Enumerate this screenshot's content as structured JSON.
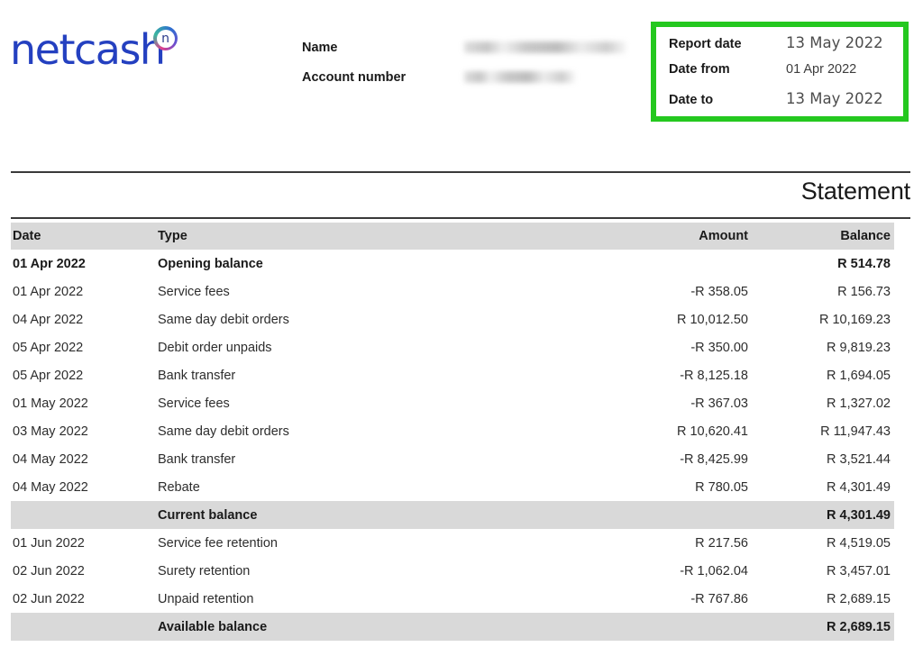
{
  "brand": {
    "logo_text": "netcash",
    "logo_mark_letter": "n",
    "logo_color": "#2440c0",
    "highlight_color": "#24c81f"
  },
  "account": {
    "rows": [
      {
        "label": "Name",
        "value": "",
        "redacted": true
      },
      {
        "label": "Account number",
        "value": "",
        "redacted": true
      }
    ]
  },
  "date_box": {
    "rows": [
      {
        "label": "Report date",
        "value": "13 May 2022"
      },
      {
        "label": "Date from",
        "value": "01 Apr 2022"
      },
      {
        "label": "Date to",
        "value": "13 May 2022"
      }
    ]
  },
  "statement": {
    "title": "Statement",
    "columns": [
      "Date",
      "Type",
      "Amount",
      "Balance"
    ],
    "rows": [
      {
        "date": "01 Apr 2022",
        "type": "Opening balance",
        "amount": "",
        "balance": "R 514.78",
        "style": "bold"
      },
      {
        "date": "01 Apr 2022",
        "type": "Service fees",
        "amount": "-R 358.05",
        "balance": "R 156.73",
        "style": "normal"
      },
      {
        "date": "04 Apr 2022",
        "type": "Same day debit orders",
        "amount": "R 10,012.50",
        "balance": "R 10,169.23",
        "style": "normal"
      },
      {
        "date": "05 Apr 2022",
        "type": "Debit order unpaids",
        "amount": "-R 350.00",
        "balance": "R 9,819.23",
        "style": "normal"
      },
      {
        "date": "05 Apr 2022",
        "type": "Bank transfer",
        "amount": "-R 8,125.18",
        "balance": "R 1,694.05",
        "style": "normal"
      },
      {
        "date": "01 May 2022",
        "type": "Service fees",
        "amount": "-R 367.03",
        "balance": "R 1,327.02",
        "style": "normal"
      },
      {
        "date": "03 May 2022",
        "type": "Same day debit orders",
        "amount": "R 10,620.41",
        "balance": "R 11,947.43",
        "style": "normal"
      },
      {
        "date": "04 May 2022",
        "type": "Bank transfer",
        "amount": "-R 8,425.99",
        "balance": "R 3,521.44",
        "style": "normal"
      },
      {
        "date": "04 May 2022",
        "type": "Rebate",
        "amount": "R 780.05",
        "balance": "R 4,301.49",
        "style": "normal"
      },
      {
        "date": "",
        "type": "Current balance",
        "amount": "",
        "balance": "R 4,301.49",
        "style": "total"
      },
      {
        "date": "01 Jun 2022",
        "type": "Service fee retention",
        "amount": "R 217.56",
        "balance": "R 4,519.05",
        "style": "normal"
      },
      {
        "date": "02 Jun 2022",
        "type": "Surety retention",
        "amount": "-R 1,062.04",
        "balance": "R 3,457.01",
        "style": "normal"
      },
      {
        "date": "02 Jun 2022",
        "type": "Unpaid retention",
        "amount": "-R 767.86",
        "balance": "R 2,689.15",
        "style": "normal"
      },
      {
        "date": "",
        "type": "Available balance",
        "amount": "",
        "balance": "R 2,689.15",
        "style": "total"
      }
    ]
  }
}
